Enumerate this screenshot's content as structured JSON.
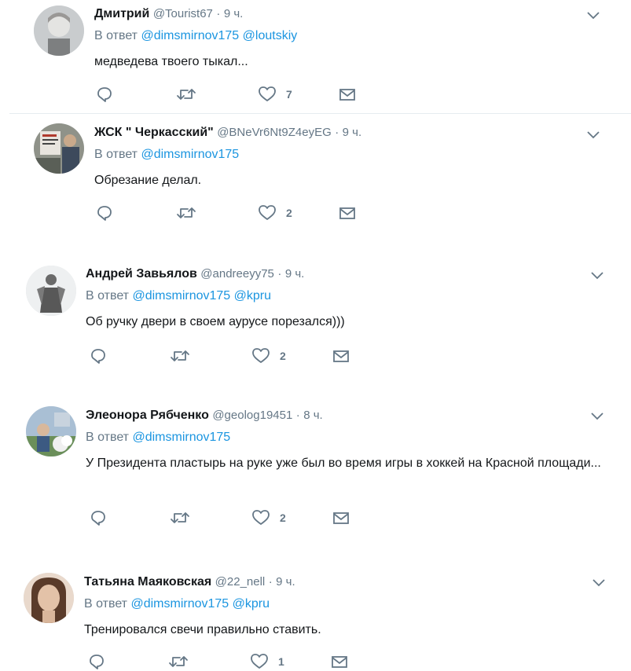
{
  "tweets": [
    {
      "name": "Дмитрий",
      "handle": "@Tourist67",
      "time": "9 ч.",
      "reply_prefix": "В ответ",
      "mentions": [
        "@dimsmirnov175",
        "@loutskiy"
      ],
      "text": "медведева твоего тыкал...",
      "likes": "7",
      "avatar_color": "#bfc3c6"
    },
    {
      "name": "ЖСК \" Черкасский\"",
      "handle": "@BNeVr6Nt9Z4eyEG",
      "time": "9 ч.",
      "reply_prefix": "В ответ",
      "mentions": [
        "@dimsmirnov175"
      ],
      "text": "Обрезание делал.",
      "likes": "2",
      "avatar_color": "#8a8f86"
    },
    {
      "name": "Андрей Завьялов",
      "handle": "@andreeyy75",
      "time": "9 ч.",
      "reply_prefix": "В ответ",
      "mentions": [
        "@dimsmirnov175",
        "@kpru"
      ],
      "text": "Об ручку двери в своем аурусе порезался)))",
      "likes": "2",
      "avatar_color": "#e9ebec"
    },
    {
      "name": "Элеонора Рябченко",
      "handle": "@geolog19451",
      "time": "8 ч.",
      "reply_prefix": "В ответ",
      "mentions": [
        "@dimsmirnov175"
      ],
      "text": "У Президента пластырь на руке уже был во время игры в хоккей на Красной площади...",
      "likes": "2",
      "avatar_color": "#9fb4c9"
    },
    {
      "name": "Татьяна Маяковская",
      "handle": "@22_nell",
      "time": "9 ч.",
      "reply_prefix": "В ответ",
      "mentions": [
        "@dimsmirnov175",
        "@kpru"
      ],
      "text": "Тренировался свечи правильно ставить.",
      "likes": "1",
      "avatar_color": "#c7a58e"
    }
  ],
  "colors": {
    "link": "#1b95e0",
    "secondary": "#657786",
    "primary_text": "#14171a",
    "divider": "#e6ecf0"
  },
  "icons": {
    "reply": "reply-icon",
    "retweet": "retweet-icon",
    "like": "heart-icon",
    "dm": "envelope-icon",
    "menu": "chevron-down-icon"
  }
}
